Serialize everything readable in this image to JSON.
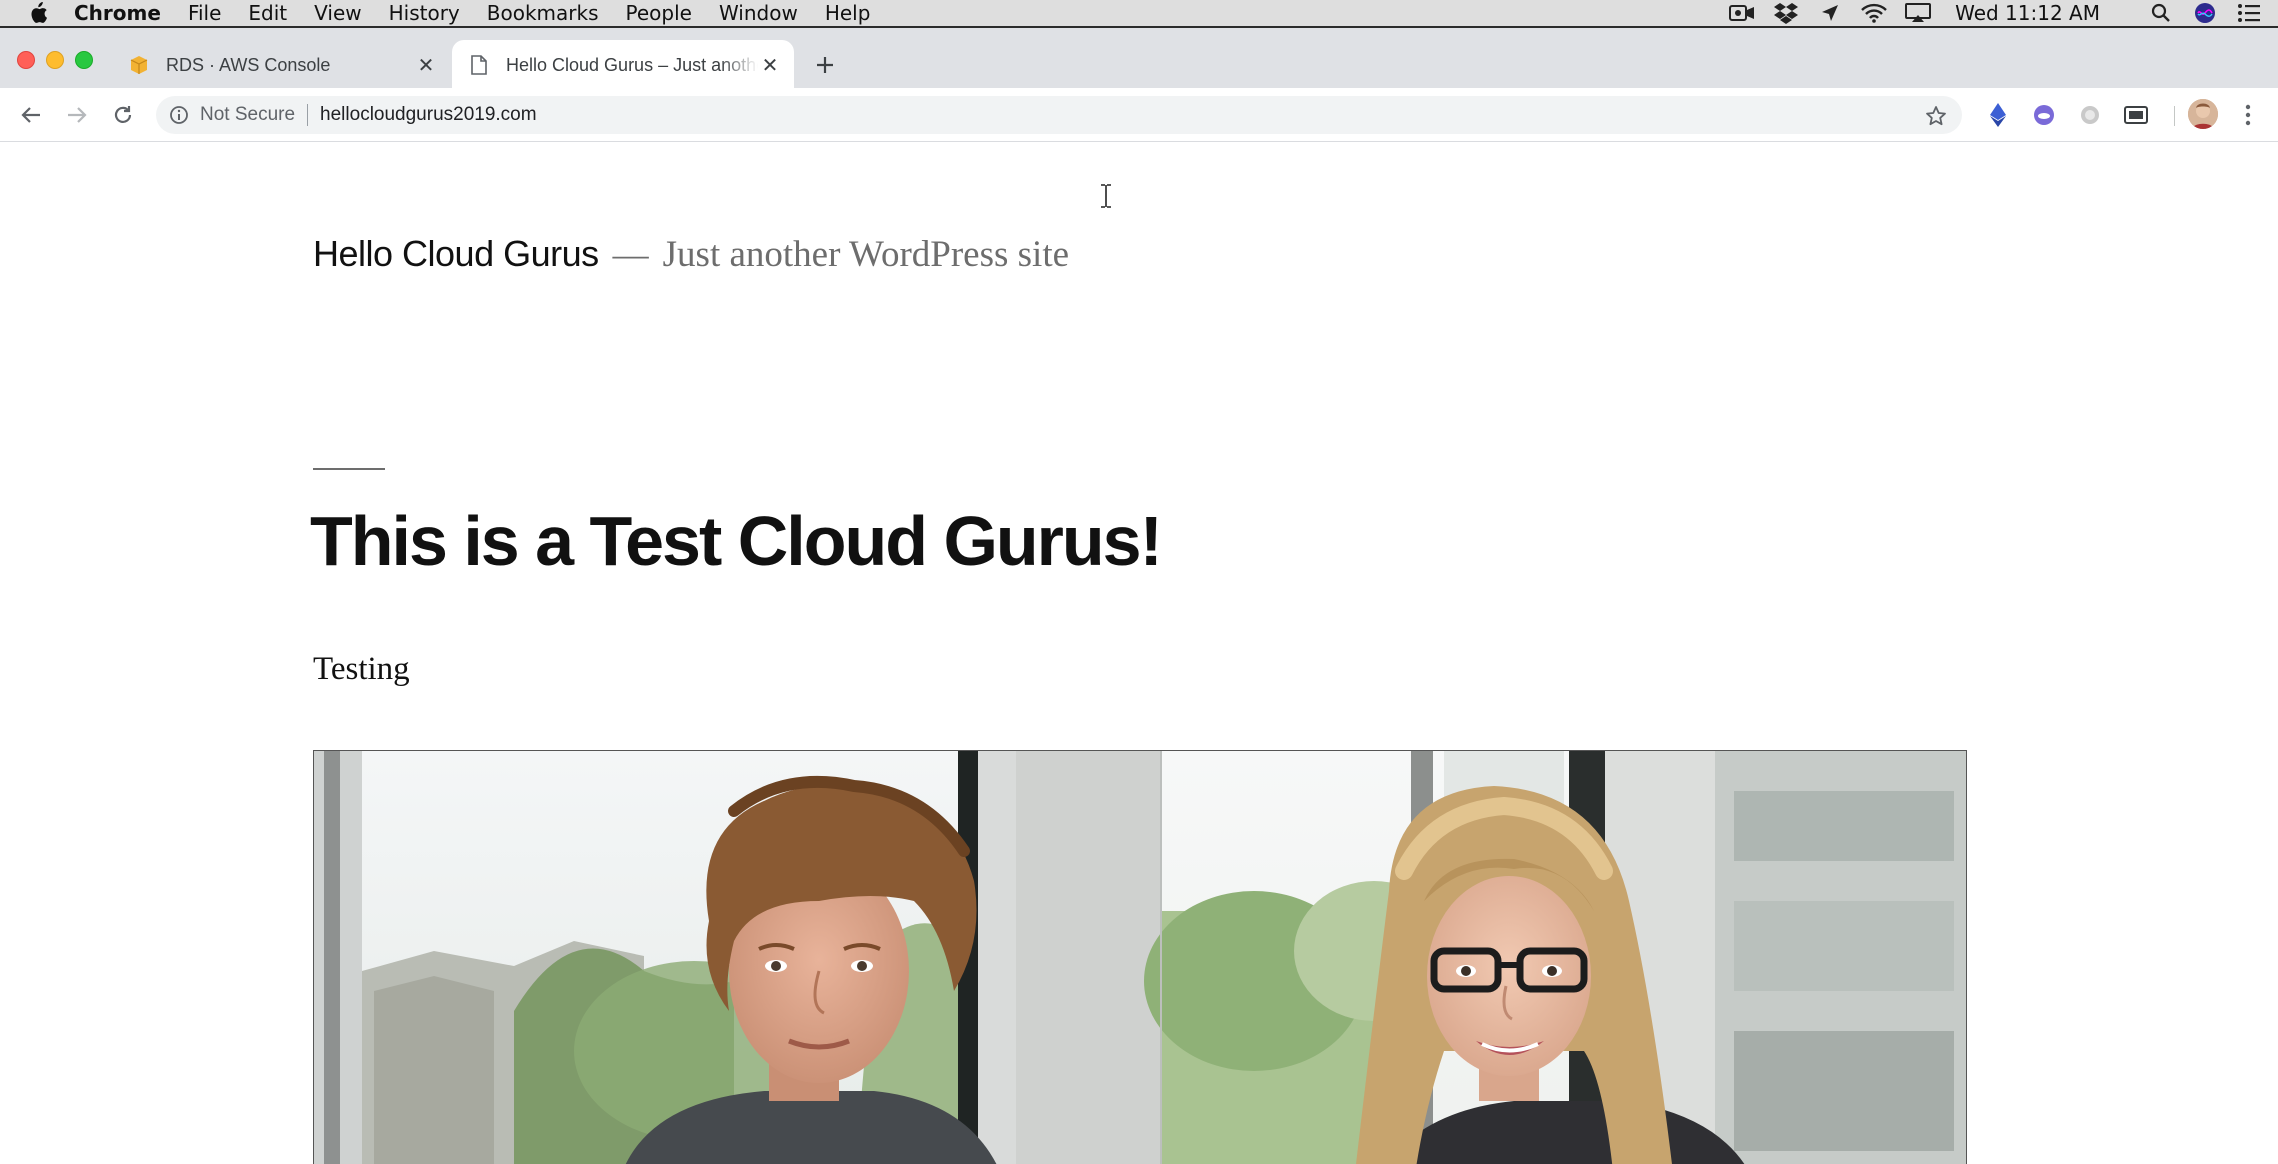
{
  "menubar": {
    "app_name": "Chrome",
    "menus": [
      "File",
      "Edit",
      "View",
      "History",
      "Bookmarks",
      "People",
      "Window",
      "Help"
    ],
    "clock": "Wed 11:12 AM"
  },
  "tabs": [
    {
      "title": "RDS · AWS Console",
      "favicon": "aws-box-icon",
      "active": false
    },
    {
      "title": "Hello Cloud Gurus – Just another WordPress site",
      "favicon": "page-icon",
      "active": true
    }
  ],
  "omnibox": {
    "security_label": "Not Secure",
    "url": "hellocloudgurus2019.com"
  },
  "page": {
    "site_title": "Hello Cloud Gurus",
    "site_separator": "—",
    "site_description": "Just another WordPress site",
    "post_title": "This is a Test Cloud Gurus!",
    "post_body": "Testing"
  },
  "colors": {
    "accent_blue": "#1a73e8",
    "menubar_bg": "#dedede",
    "tabstrip_bg": "#dfe1e5",
    "omnibox_bg": "#f1f3f4",
    "muted_text": "#6d6d6d"
  }
}
